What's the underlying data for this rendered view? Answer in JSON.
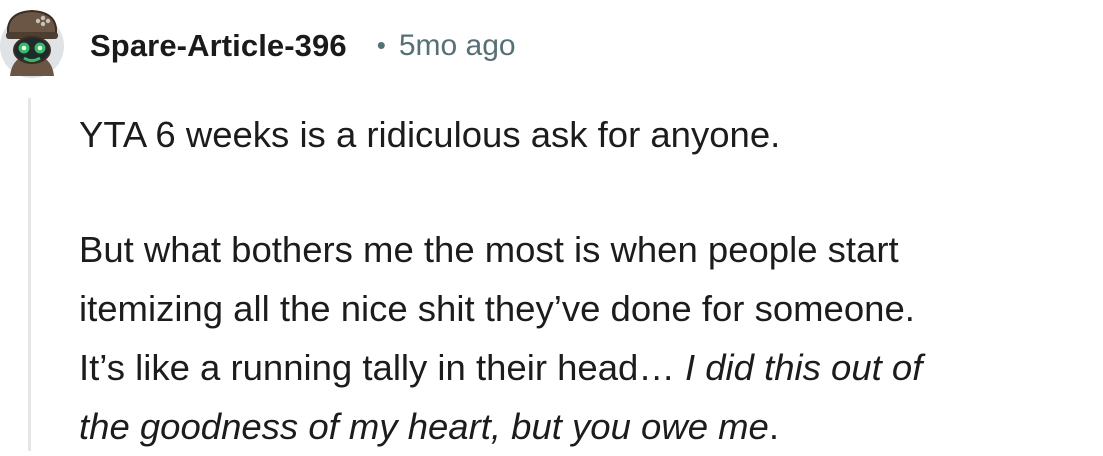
{
  "comment": {
    "author": "Spare-Article-396",
    "separator": "•",
    "time_ago": "5mo ago",
    "avatar_icon": "robot-avatar-icon",
    "paragraphs": {
      "first": "YTA 6 weeks is a ridiculous ask for anyone.",
      "second_line1": "But what bothers me the most is when people start",
      "second_line2": "itemizing all the nice shit they’ve done for someone.",
      "second_line3_plain": "It’s like a running tally in their head… ",
      "second_line3_italic": "I did this out of",
      "second_line4_italic": "the goodness of my heart, but you owe me",
      "second_line4_end": "."
    }
  },
  "colors": {
    "author": "#1a1a1b",
    "meta": "#576f76",
    "body": "#1c1c1c",
    "thread_line": "#e4e6e8"
  }
}
